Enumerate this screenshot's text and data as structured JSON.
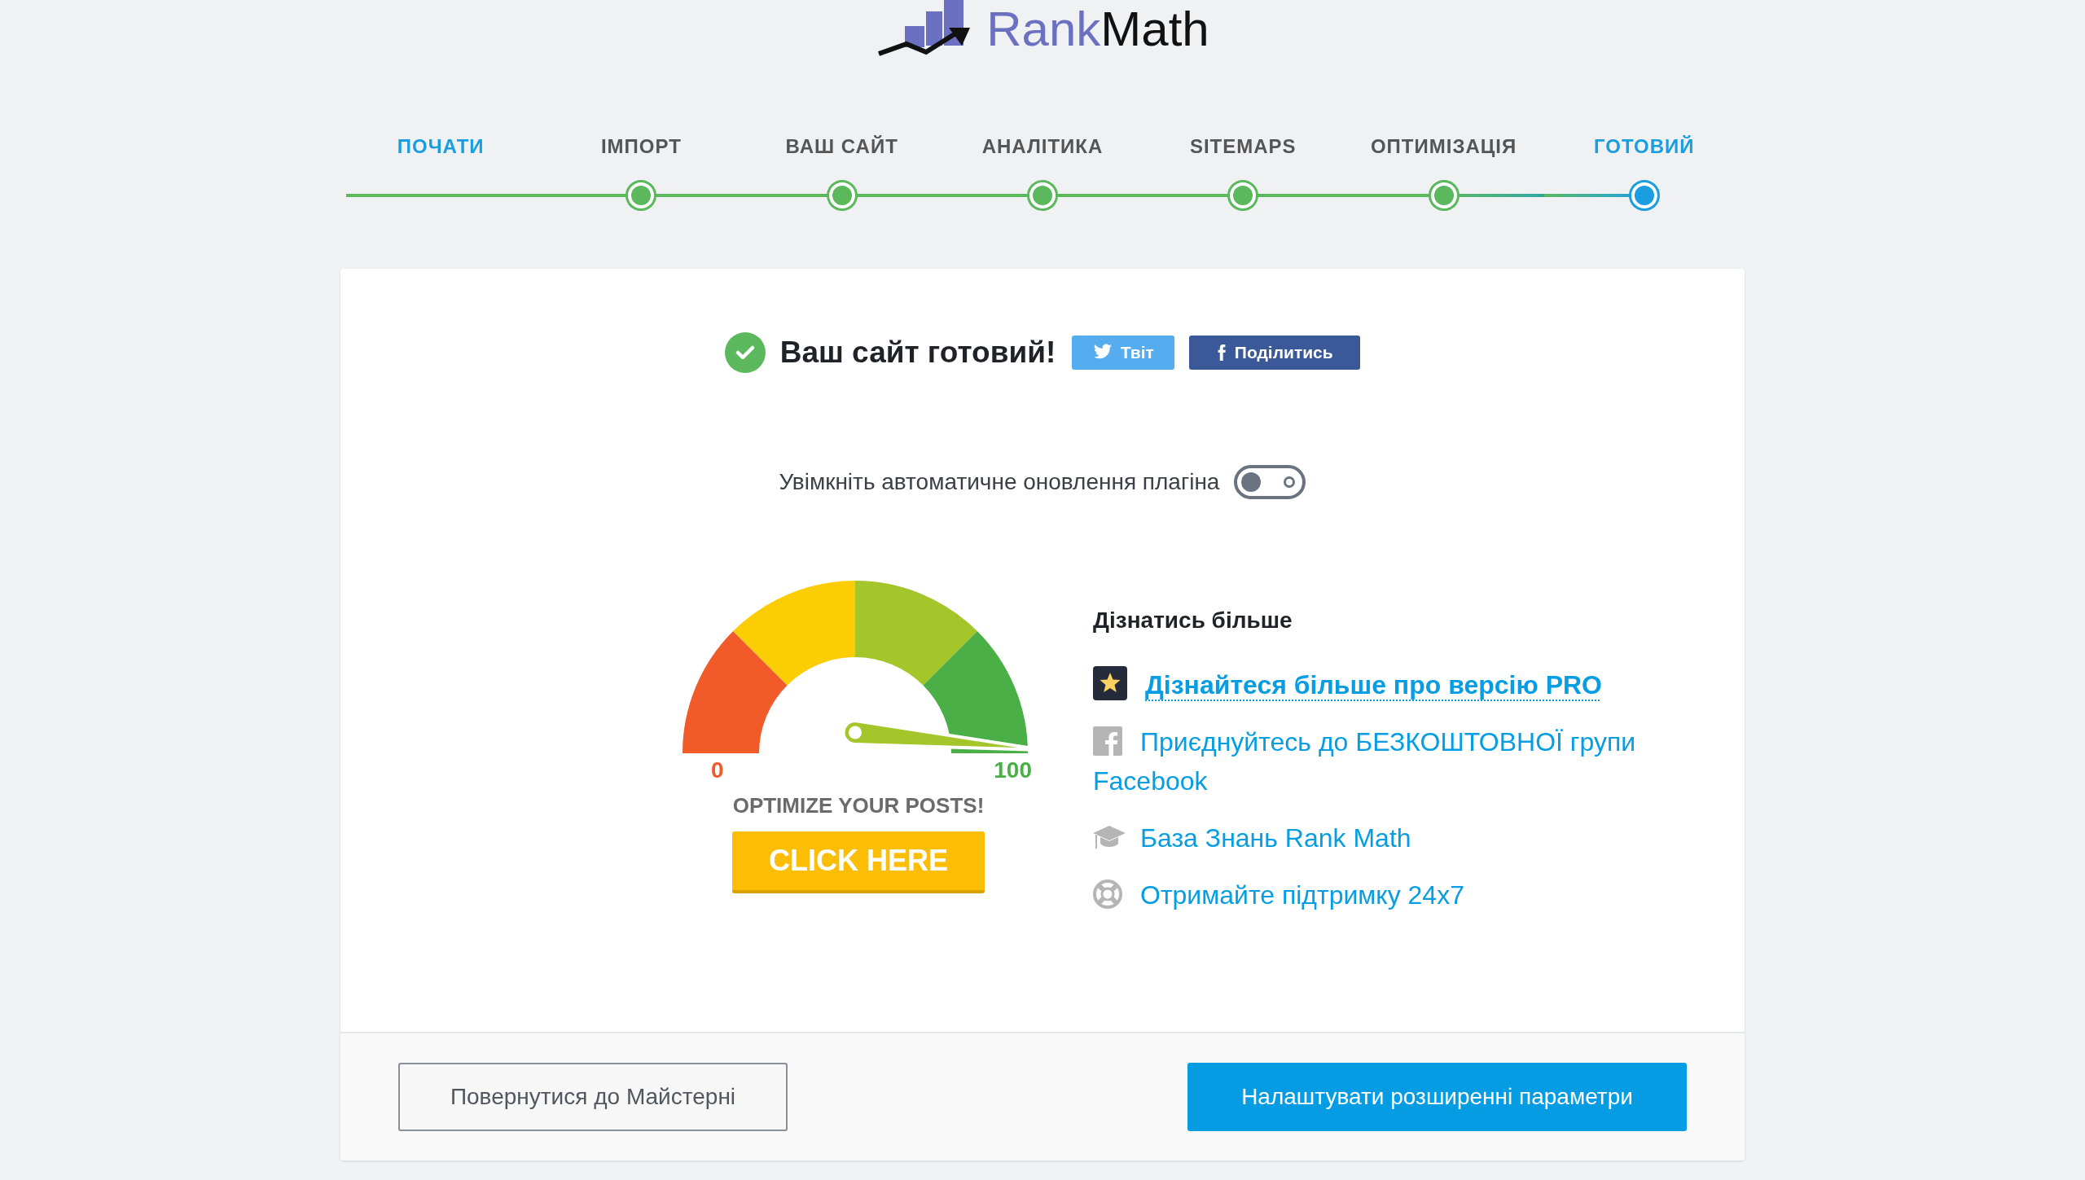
{
  "logo": {
    "parts": [
      {
        "text": "Rank",
        "kind": "accent"
      },
      {
        "text": "Math",
        "kind": "plain"
      }
    ]
  },
  "steps": [
    {
      "label": "ПОЧАТИ",
      "kind": "start"
    },
    {
      "label": "ІМПОРТ",
      "kind": "done"
    },
    {
      "label": "ВАШ САЙТ",
      "kind": "done"
    },
    {
      "label": "АНАЛІТИКА",
      "kind": "done"
    },
    {
      "label": "SITEMAPS",
      "kind": "done"
    },
    {
      "label": "ОПТИМІЗАЦІЯ",
      "kind": "done"
    },
    {
      "label": "ГОТОВИЙ",
      "kind": "current"
    }
  ],
  "card": {
    "title": "Ваш сайт готовий!",
    "share_buttons": [
      {
        "label": "Твіт",
        "kind": "twitter"
      },
      {
        "label": "Поділитись",
        "kind": "facebook"
      }
    ],
    "auto_update": {
      "label": "Увімкніть автоматичне оновлення плагіна",
      "on": false
    },
    "promo": {
      "min_label": "0",
      "max_label": "100",
      "caption": "OPTIMIZE YOUR POSTS!",
      "button": "CLICK HERE"
    },
    "learn_more": {
      "heading": "Дізнатись більше",
      "links": [
        {
          "label": "Дізнайтеся більше про версію PRO",
          "kind": "star",
          "emphasized": true
        },
        {
          "label": "Приєднуйтесь до БЕЗКОШТОВНОЇ групи Facebook",
          "kind": "facebook",
          "emphasized": false
        },
        {
          "label": "База Знань Rank Math",
          "kind": "graduation",
          "emphasized": false
        },
        {
          "label": "Отримайте підтримку 24x7",
          "kind": "support",
          "emphasized": false
        }
      ]
    }
  },
  "footer": {
    "back_button": "Повернутися до Майстерні",
    "advanced_button": "Налаштувати розширенні параметри"
  }
}
